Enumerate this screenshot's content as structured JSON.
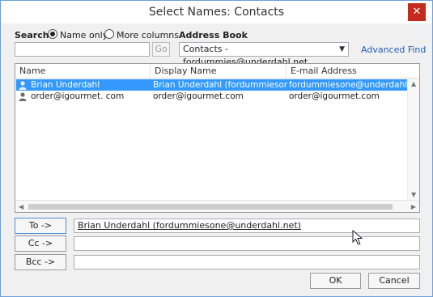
{
  "window": {
    "title": "Select Names: Contacts",
    "close_glyph": "✕"
  },
  "search": {
    "label": "Search:",
    "options": [
      {
        "label": "Name only",
        "selected": true
      },
      {
        "label": "More columns",
        "selected": false
      }
    ],
    "input_value": "",
    "go_label": "Go"
  },
  "address_book": {
    "label": "Address Book",
    "selected": "Contacts - fordummies@underdahl.net",
    "advanced_find": "Advanced Find"
  },
  "list": {
    "columns": [
      "Name",
      "Display Name",
      "E-mail Address"
    ],
    "rows": [
      {
        "name": "Brian Underdahl",
        "display_name": "Brian Underdahl (fordummiesone...",
        "email": "fordummiesone@underdahl.net",
        "selected": true
      },
      {
        "name": "order@igourmet. com",
        "display_name": "order@igourmet.com",
        "email": "order@igourmet.com",
        "selected": false
      }
    ]
  },
  "recipients": [
    {
      "button": "To ->",
      "value": "Brian Underdahl (fordummiesone@underdahl.net)"
    },
    {
      "button": "Cc ->",
      "value": ""
    },
    {
      "button": "Bcc ->",
      "value": ""
    }
  ],
  "footer": {
    "ok": "OK",
    "cancel": "Cancel"
  },
  "colors": {
    "selection": "#3399ff",
    "link": "#1f5fb8",
    "close_button": "#c42b1c"
  }
}
